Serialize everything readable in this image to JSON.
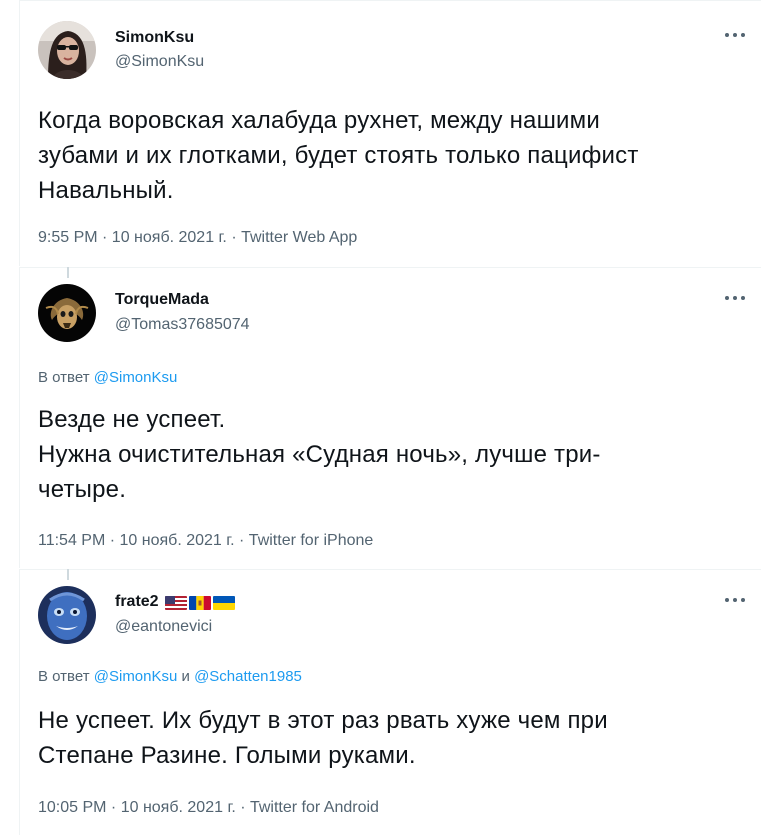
{
  "tweets": [
    {
      "name": "SimonKsu",
      "handle": "@SimonKsu",
      "text": "Когда воровская халабуда рухнет, между нашими\nзубами и их глотками, будет стоять только пацифист\nНавальный.",
      "meta": "9:55 PM · 10 нояб. 2021 г. · Twitter Web App",
      "more_icon": "more-options-icon"
    },
    {
      "name": "TorqueMada",
      "handle": "@Tomas37685074",
      "reply_prefix": "В ответ",
      "reply_to": "@SimonKsu",
      "text": "Везде не успеет.\nНужна очистительная «Судная ночь», лучше три-\nчетыре.",
      "meta": "11:54 PM · 10 нояб. 2021 г. · Twitter for iPhone",
      "more_icon": "more-options-icon"
    },
    {
      "name": "frate2",
      "flags": [
        "us-flag-icon",
        "moldova-flag-icon",
        "ukraine-flag-icon"
      ],
      "handle": "@eantonevici",
      "reply_prefix": "В ответ",
      "reply_to": "@SimonKsu",
      "reply_and": "и",
      "reply_to_2": "@Schatten1985",
      "text": "Не успеет. Их будут в этот раз рвать хуже чем при\nСтепане Разине. Голыми руками.",
      "meta": "10:05 PM · 10 нояб. 2021 г. · Twitter for Android",
      "more_icon": "more-options-icon"
    }
  ],
  "colors": {
    "text": "#0f1419",
    "secondary": "#536471",
    "link": "#1d9bf0",
    "divider": "#eff3f4"
  }
}
